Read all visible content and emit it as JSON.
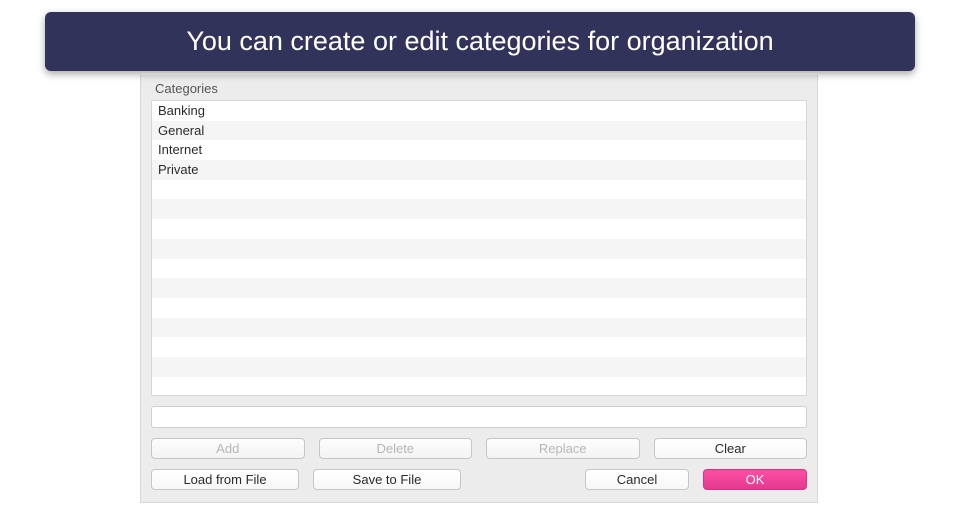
{
  "annotation": "You can create or edit categories for organization",
  "dialog": {
    "section_label": "Categories",
    "categories": [
      "Banking",
      "General",
      "Internet",
      "Private"
    ],
    "input_value": "",
    "actions": {
      "add": "Add",
      "delete": "Delete",
      "replace": "Replace",
      "clear": "Clear",
      "load": "Load from File",
      "save": "Save to File",
      "cancel": "Cancel",
      "ok": "OK"
    }
  },
  "colors": {
    "banner_bg": "#32335a",
    "primary_btn": "#e23a8f"
  }
}
